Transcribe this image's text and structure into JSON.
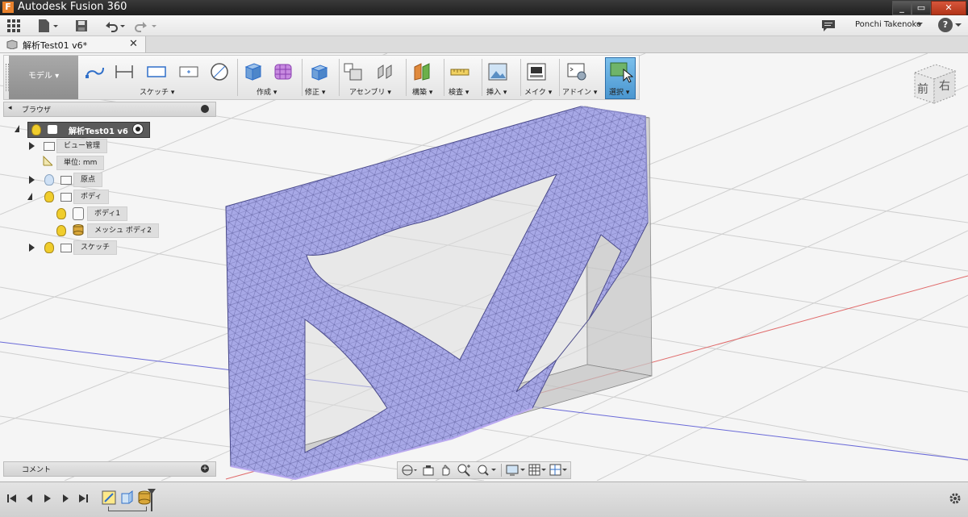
{
  "window": {
    "app_title": "Autodesk Fusion 360",
    "app_logo": "F",
    "controls": [
      "_",
      "▭",
      "✕"
    ]
  },
  "qab": {
    "user_name": "Ponchi Takenoko",
    "help": "?"
  },
  "document_tab": {
    "title": "解析Test01 v6*"
  },
  "toolbar": {
    "workspace": "モデル",
    "groups": [
      "スケッチ",
      "作成",
      "修正",
      "アセンブリ",
      "構築",
      "検査",
      "挿入",
      "メイク",
      "アドイン",
      "選択"
    ]
  },
  "viewcube": {
    "front": "前",
    "right": "右"
  },
  "browser": {
    "title": "ブラウザ",
    "root": "解析Test01 v6",
    "items": [
      {
        "label": "ビュー管理"
      },
      {
        "label": "単位: mm"
      },
      {
        "label": "原点"
      },
      {
        "label": "ボディ"
      },
      {
        "label": "ボディ1"
      },
      {
        "label": "メッシュ ボディ2"
      },
      {
        "label": "スケッチ"
      }
    ]
  },
  "comments": {
    "title": "コメント"
  },
  "colors": {
    "mesh_fill": "#a7a8e6",
    "mesh_edge": "#4a4a8a",
    "accent_select": "#5aa0d8",
    "bulb_on": "#f0cd2c"
  }
}
